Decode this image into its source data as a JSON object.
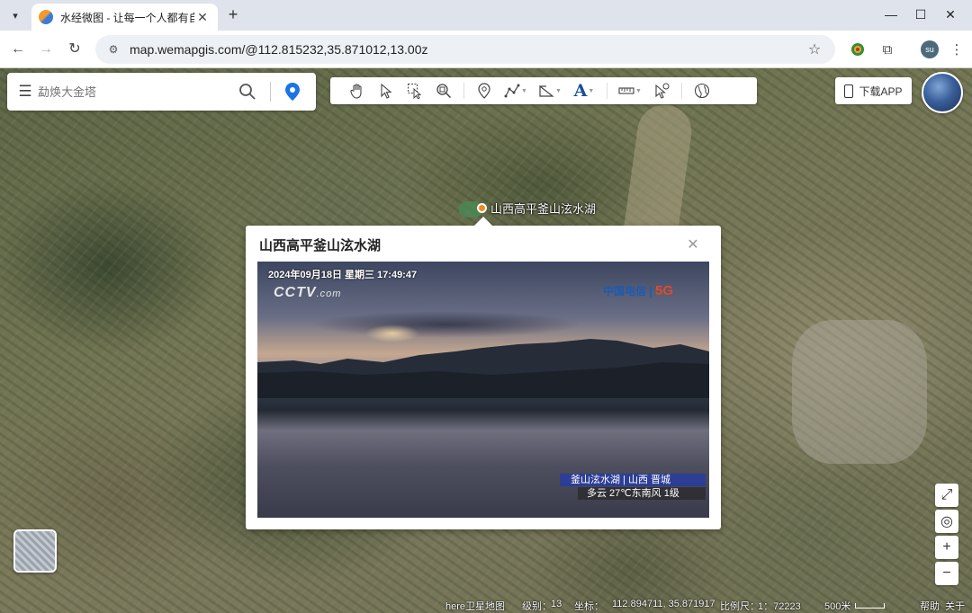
{
  "browser": {
    "tab_title": "水经微图 - 让每一个人都有自己",
    "url": "map.wemapgis.com/@112.815232,35.871012,13.00z",
    "profile_initials": "su"
  },
  "search": {
    "placeholder": "勐焕大金塔"
  },
  "toolbar": {
    "download_app_label": "下载APP"
  },
  "poi": {
    "label": "山西高平釜山泫水湖"
  },
  "popup": {
    "title": "山西高平釜山泫水湖",
    "video_timestamp": "2024年09月18日  星期三  17:49:47",
    "cctv_logo": "CCTV",
    "cctv_suffix": ".com",
    "telecom_logo": "中国电信",
    "telecom_5g": "5G",
    "caption_location": "釜山泫水湖 | 山西 晋城",
    "caption_weather": "多云 27℃东南风 1级"
  },
  "status": {
    "map_source": "here卫星地图",
    "level_label": "级别：",
    "level_value": "13",
    "coord_label": "坐标：",
    "coord_value": "112.894711, 35.871917",
    "scale_label": "比例尺：",
    "scale_value": "1：72223",
    "scale_distance": "500米",
    "help": "帮助",
    "about": "关于"
  },
  "colors": {
    "poi_marker": "#f28a22",
    "location_pin": "#1a73e8"
  }
}
